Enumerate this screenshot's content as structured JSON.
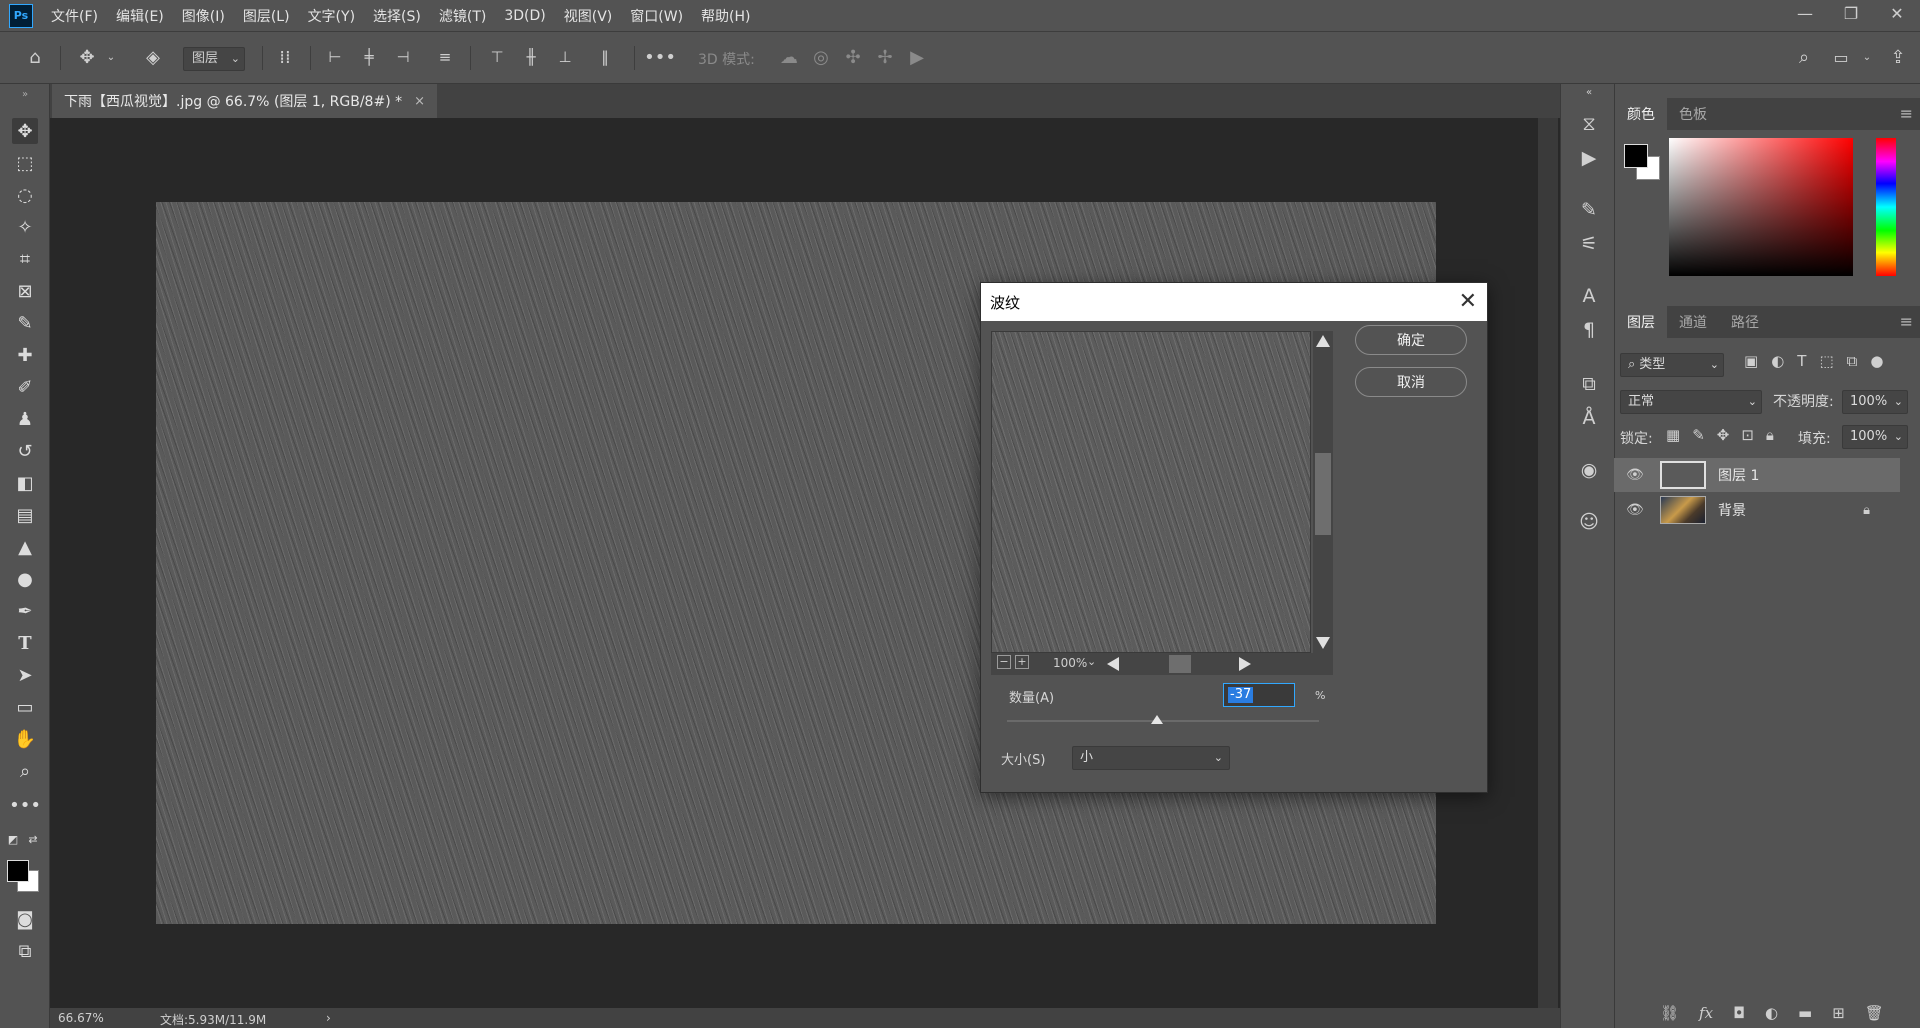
{
  "app": {
    "logo": "Ps"
  },
  "menu": {
    "items": [
      "文件(F)",
      "编辑(E)",
      "图像(I)",
      "图层(L)",
      "文字(Y)",
      "选择(S)",
      "滤镜(T)",
      "3D(D)",
      "视图(V)",
      "窗口(W)",
      "帮助(H)"
    ]
  },
  "window_controls": {
    "minimize": "—",
    "restore": "❐",
    "close": "✕"
  },
  "options_bar": {
    "layer_select": "图层",
    "mode_label": "3D 模式:"
  },
  "document_tab": {
    "title": "下雨【西瓜视觉】.jpg @ 66.7% (图层 1, RGB/8#) *",
    "close": "×"
  },
  "status": {
    "zoom": "66.67%",
    "doc_size": "文档:5.93M/11.9M",
    "arrow": "›"
  },
  "color_panel": {
    "tabs": [
      "颜色",
      "色板"
    ],
    "active_tab": 0,
    "foreground": "#000000",
    "background": "#ffffff"
  },
  "layers_panel": {
    "tabs": [
      "图层",
      "通道",
      "路径"
    ],
    "filter_kind": "类型",
    "blend_mode": "正常",
    "opacity_label": "不透明度:",
    "opacity_value": "100%",
    "lock_label": "锁定:",
    "fill_label": "填充:",
    "fill_value": "100%",
    "layers": [
      {
        "name": "图层 1",
        "visible": true,
        "selected": true,
        "locked": false
      },
      {
        "name": "背景",
        "visible": true,
        "selected": false,
        "locked": true
      }
    ]
  },
  "dialog": {
    "title": "波纹",
    "ok_label": "确定",
    "cancel_label": "取消",
    "preview_zoom": "100%",
    "amount_label": "数量(A)",
    "amount_value": "-37",
    "amount_unit": "%",
    "amount_min": -999,
    "amount_max": 999,
    "size_label": "大小(S)",
    "size_value": "小"
  }
}
